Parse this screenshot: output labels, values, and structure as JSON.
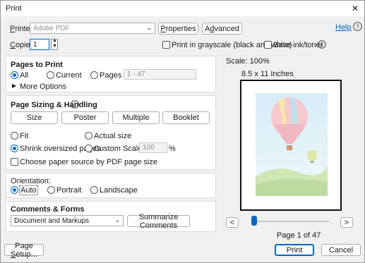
{
  "window": {
    "title": "Print",
    "close_glyph": "✕"
  },
  "printer": {
    "label": "Printer:",
    "name": "Adobe PDF",
    "properties_label": "Properties",
    "advanced_label": "Advanced",
    "help_label": "Help"
  },
  "copies": {
    "label": "Copies:",
    "value": "1"
  },
  "options": {
    "grayscale_label": "Print in grayscale (black and white)",
    "save_ink_label": "Save ink/toner"
  },
  "pages_to_print": {
    "title": "Pages to Print",
    "all_label": "All",
    "current_label": "Current",
    "pages_label": "Pages",
    "pages_value": "1 - 47",
    "more_options_label": "More Options"
  },
  "sizing": {
    "title": "Page Sizing & Handling",
    "tabs": [
      "Size",
      "Poster",
      "Multiple",
      "Booklet"
    ],
    "fit_label": "Fit",
    "actual_label": "Actual size",
    "shrink_label": "Shrink oversized pages",
    "custom_label": "Custom Scale:",
    "custom_value": "100",
    "percent": "%",
    "paper_source_label": "Choose paper source by PDF page size"
  },
  "orientation": {
    "title": "Orientation:",
    "auto_label": "Auto",
    "portrait_label": "Portrait",
    "landscape_label": "Landscape"
  },
  "comments": {
    "title": "Comments & Forms",
    "select_value": "Document and Markups",
    "summarize_label": "Summarize Comments"
  },
  "preview": {
    "scale": "Scale: 100%",
    "paper": "8.5 x 11 Inches",
    "page_info": "Page 1 of 47",
    "prev_glyph": "<",
    "next_glyph": ">",
    "slider_position": 0
  },
  "footer": {
    "page_setup_label": "Page Setup...",
    "print_label": "Print",
    "cancel_label": "Cancel"
  },
  "colors": {
    "accent": "#0067c0",
    "help_link": "#0067c0"
  }
}
